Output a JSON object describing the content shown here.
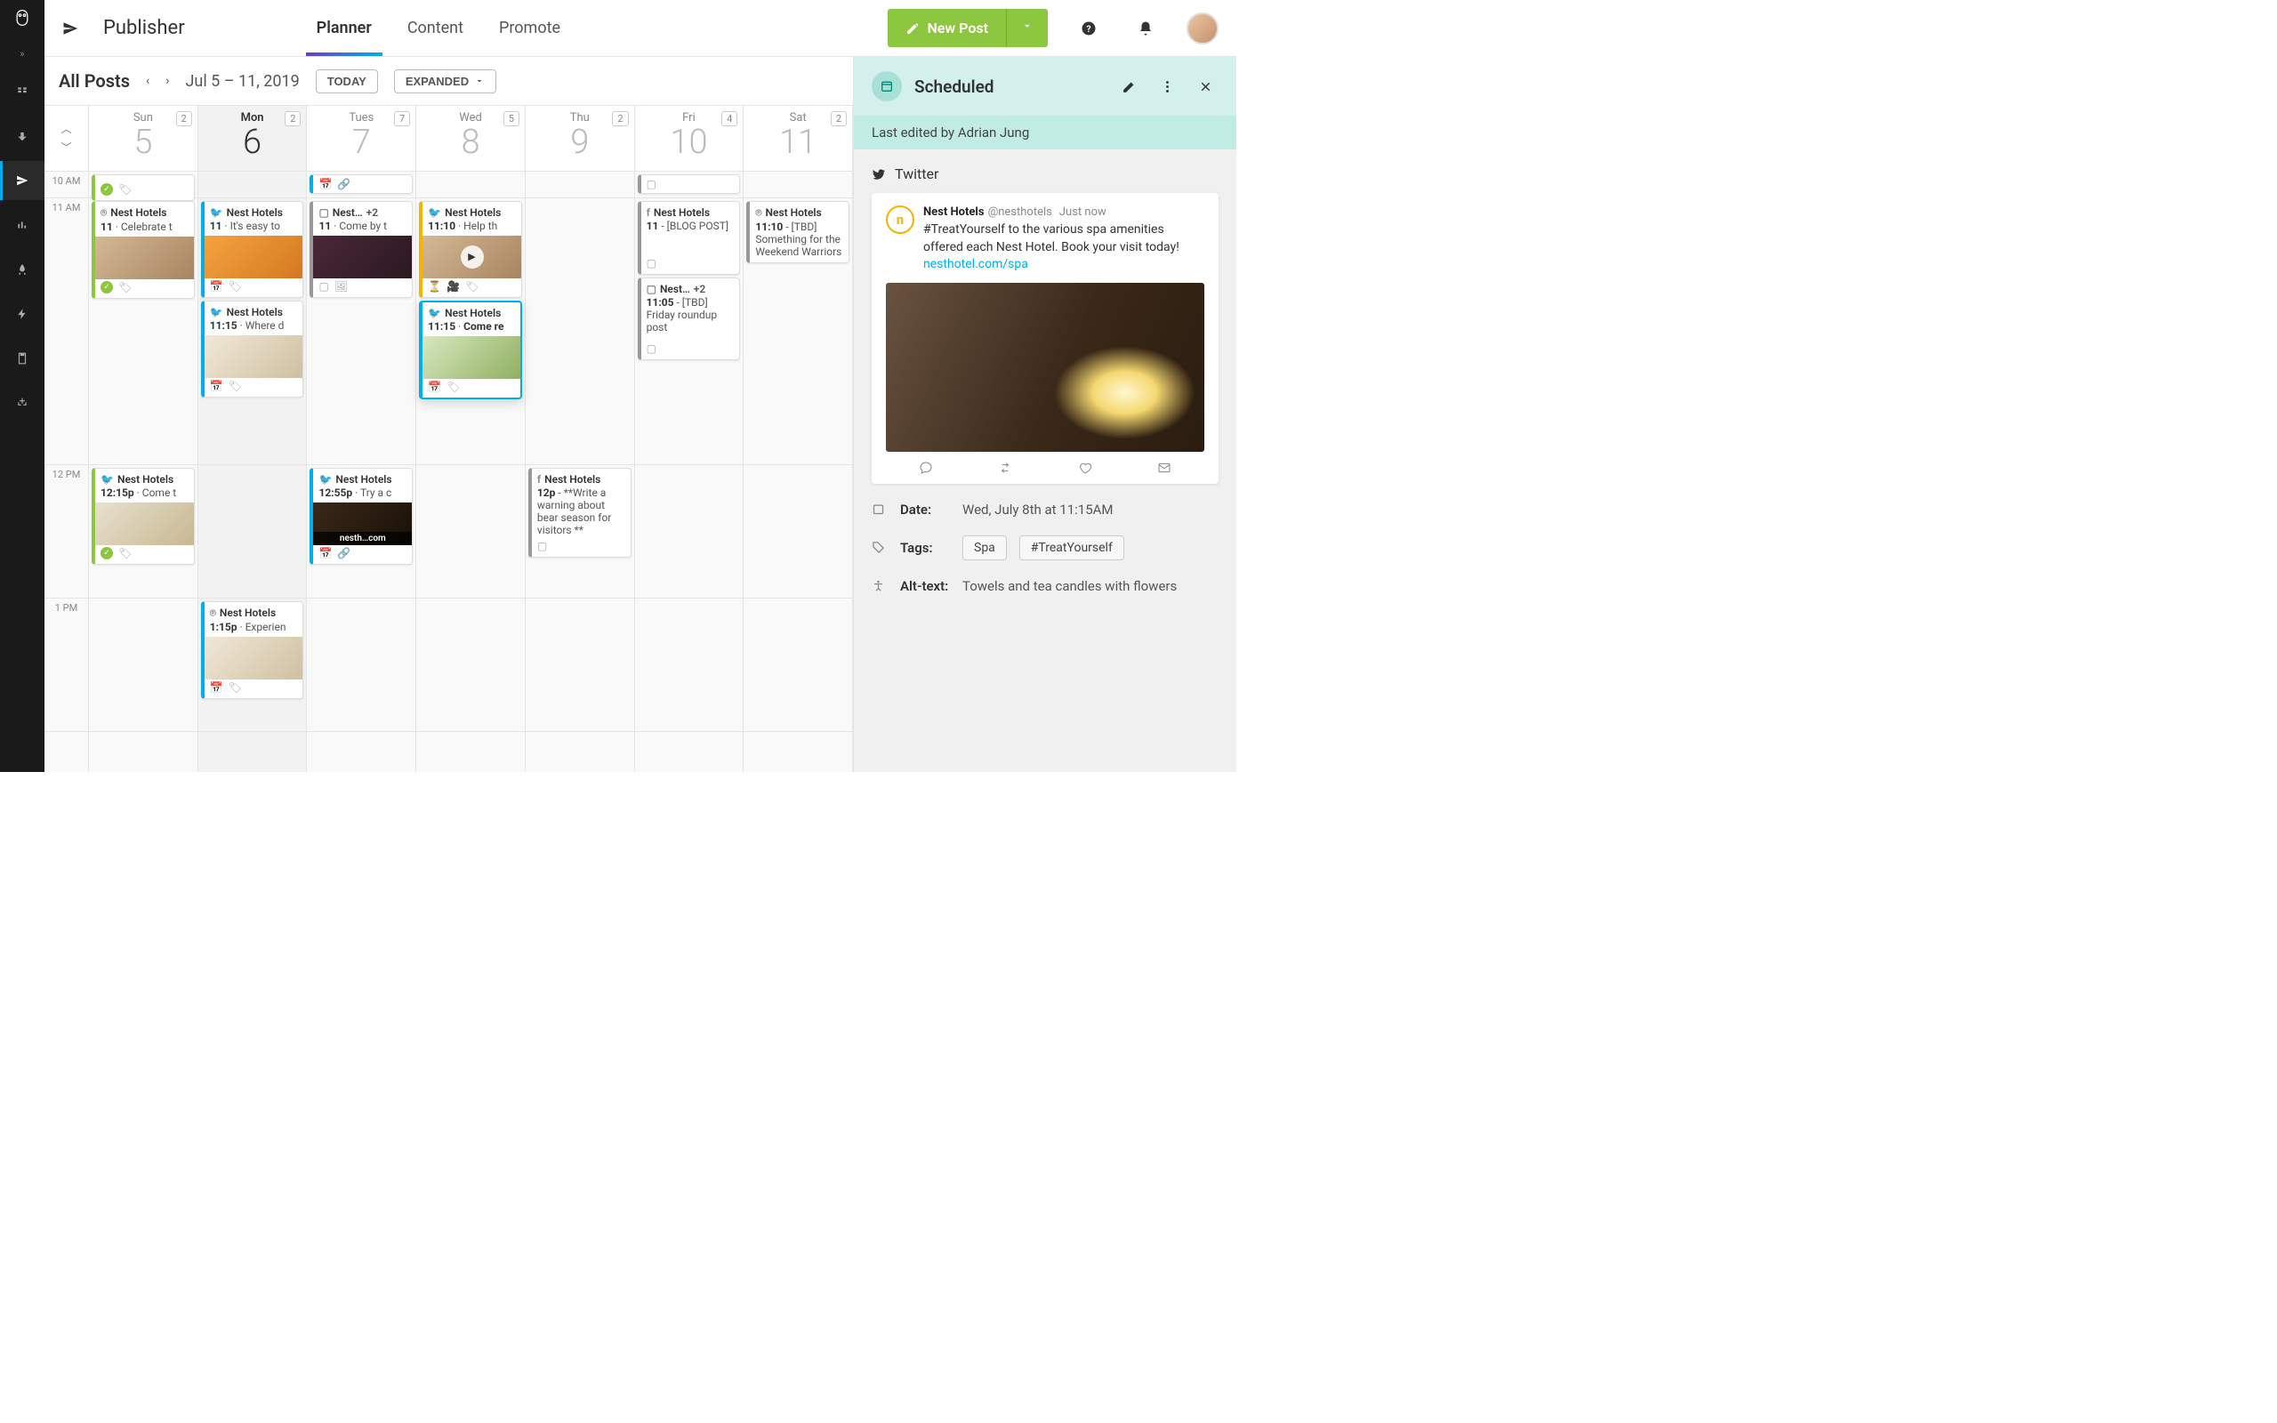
{
  "topbar": {
    "title": "Publisher",
    "tabs": [
      "Planner",
      "Content",
      "Promote"
    ],
    "newpost": "New Post"
  },
  "calhead": {
    "label": "All Posts",
    "range": "Jul 5 – 11, 2019",
    "today": "TODAY",
    "expanded": "EXPANDED"
  },
  "days": [
    {
      "dow": "Sun",
      "num": "5",
      "badge": "2"
    },
    {
      "dow": "Mon",
      "num": "6",
      "badge": "2",
      "cur": true
    },
    {
      "dow": "Tues",
      "num": "7",
      "badge": "7"
    },
    {
      "dow": "Wed",
      "num": "8",
      "badge": "5"
    },
    {
      "dow": "Thu",
      "num": "9",
      "badge": "2"
    },
    {
      "dow": "Fri",
      "num": "10",
      "badge": "4"
    },
    {
      "dow": "Sat",
      "num": "11",
      "badge": "2"
    }
  ],
  "times": [
    "10 AM",
    "11 AM",
    "12 PM",
    "1 PM"
  ],
  "cards": {
    "sun_10_sent": {
      "acct": "",
      "time": "",
      "text": ""
    },
    "sun_11": {
      "acct": "Nest Hotels",
      "time": "11",
      "text": "Celebrate t"
    },
    "sun_12": {
      "acct": "Nest Hotels",
      "time": "12:15p",
      "text": "Come t"
    },
    "mon_11a": {
      "acct": "Nest Hotels",
      "time": "11",
      "text": "It's easy to"
    },
    "mon_11b": {
      "acct": "Nest Hotels",
      "time": "11:15",
      "text": "Where d"
    },
    "mon_1": {
      "acct": "Nest Hotels",
      "time": "1:15p",
      "text": "Experien"
    },
    "tue_11": {
      "acct": "Nest…",
      "plus": "+2",
      "time": "11",
      "text": "Come by t"
    },
    "tue_12": {
      "acct": "Nest Hotels",
      "time": "12:55p",
      "text": "Try a c",
      "overlay": "nesth…com"
    },
    "wed_11a": {
      "acct": "Nest Hotels",
      "time": "11:10",
      "text": "Help th"
    },
    "wed_11b": {
      "acct": "Nest Hotels",
      "time": "11:15",
      "text": "Come re"
    },
    "thu_12": {
      "acct": "Nest Hotels",
      "time": "12p",
      "text": "**Write a warning about bear season for visitors **"
    },
    "fri_11a": {
      "acct": "Nest Hotels",
      "time": "11",
      "text": "[BLOG POST]"
    },
    "fri_11b": {
      "acct": "Nest…",
      "plus": "+2",
      "time": "11:05",
      "text": "[TBD] Friday roundup post"
    },
    "sat_11": {
      "acct": "Nest Hotels",
      "time": "11:10",
      "text": "[TBD] Something for the Weekend Warriors"
    }
  },
  "side": {
    "title": "Scheduled",
    "sub": "Last edited by Adrian Jung",
    "network": "Twitter",
    "tweet": {
      "name": "Nest Hotels",
      "handle": "@nesthotels",
      "ts": "Just now",
      "text": "#TreatYourself to the various spa amenities offered each Nest Hotel. Book your visit today! ",
      "link": "nesthotel.com/spa"
    },
    "date_lbl": "Date:",
    "date": "Wed, July 8th at 11:15AM",
    "tags_lbl": "Tags:",
    "tags": [
      "Spa",
      "#TreatYourself"
    ],
    "alt_lbl": "Alt-text:",
    "alt": "Towels and tea candles with flowers"
  }
}
